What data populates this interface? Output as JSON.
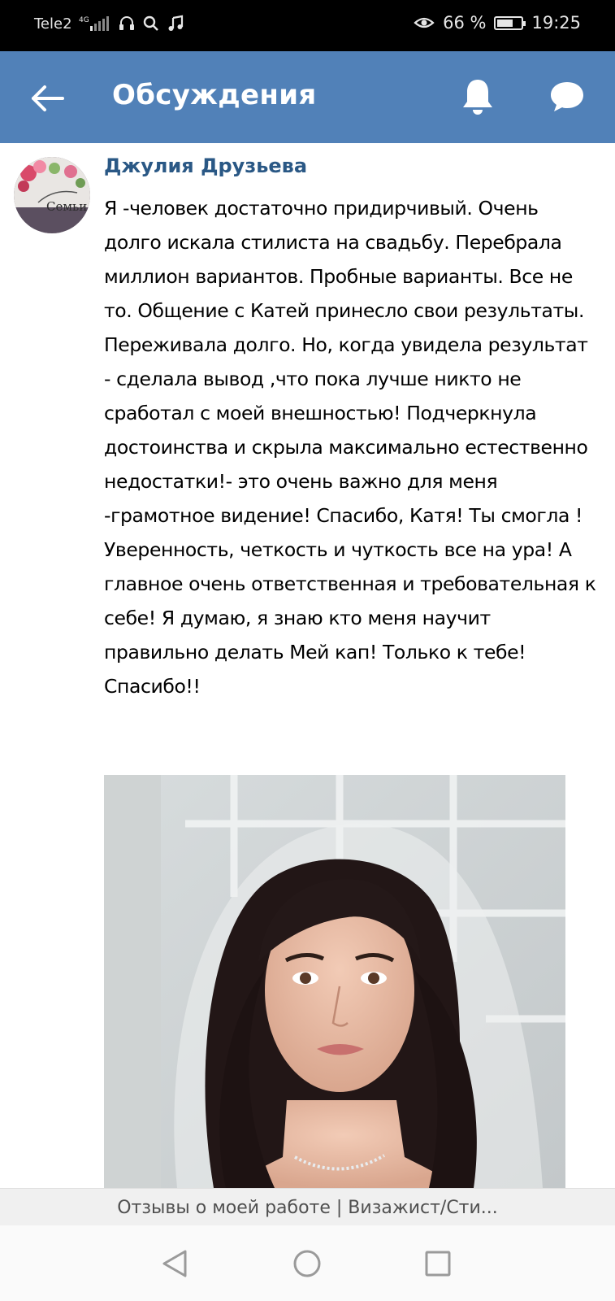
{
  "status_bar": {
    "carrier": "Tele2",
    "network": "4G",
    "battery_text": "66 %",
    "battery_level": 0.66,
    "time": "19:25"
  },
  "header": {
    "title": "Обсуждения"
  },
  "post": {
    "author": "Джулия Друзьева",
    "avatar_caption": "Семьи",
    "text": "Я -человек достаточно придирчивый. Очень долго искала стилиста на свадьбу. Перебрала миллион вариантов. Пробные варианты. Все не то. Общение с Катей принесло свои результаты. Переживала долго. Но, когда увидела результат - сделала вывод ,что пока лучше никто не сработал с моей внешностью! Подчеркнула достоинства и скрыла максимально естественно недостатки!- это очень важно для меня -грамотное видение! Спасибо, Катя! Ты смогла ! Уверенность, четкость и чуткость все на ура! А главное очень ответственная и требовательная к себе! Я думаю, я знаю кто меня научит правильно делать Мей кап! Только к тебе! Спасибо!!"
  },
  "page_title": "Отзывы о моей работе | Визажист/Сти...",
  "colors": {
    "header_bg": "#5181b8",
    "author_link": "#2a5885"
  }
}
